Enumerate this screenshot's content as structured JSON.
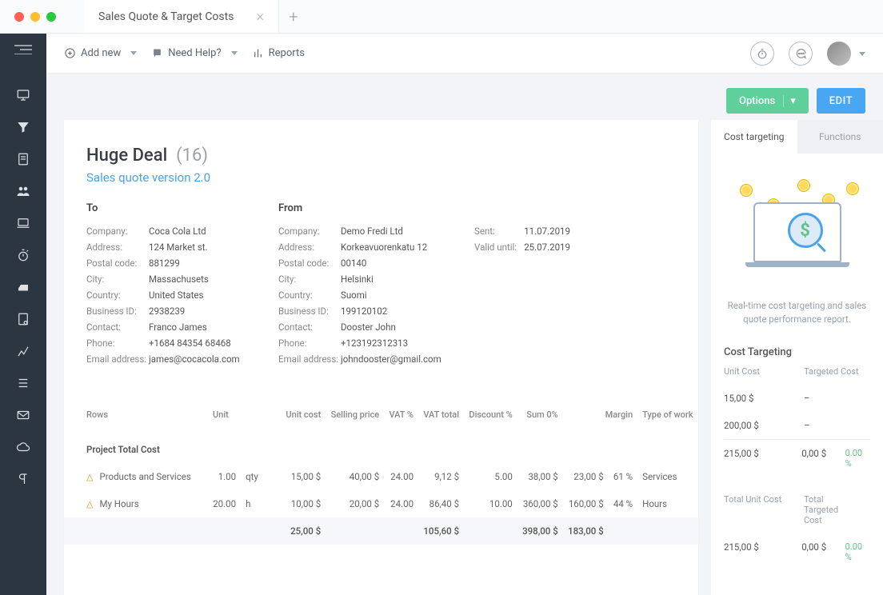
{
  "window": {
    "tab_title": "Sales Quote & Target Costs"
  },
  "toolbar": {
    "add_new": "Add new",
    "need_help": "Need Help?",
    "reports": "Reports"
  },
  "actions": {
    "options": "Options",
    "edit": "EDIT"
  },
  "deal": {
    "title": "Huge Deal",
    "count": "(16)",
    "subtitle": "Sales quote version 2.0"
  },
  "to": {
    "heading": "To",
    "company_l": "Company:",
    "company": "Coca Cola Ltd",
    "address_l": "Address:",
    "address": "124 Market st.",
    "postal_l": "Postal code:",
    "postal": "881299",
    "city_l": "City:",
    "city": "Massachusets",
    "country_l": "Country:",
    "country": "United States",
    "bizid_l": "Business ID:",
    "bizid": "2938239",
    "contact_l": "Contact:",
    "contact": "Franco James",
    "phone_l": "Phone:",
    "phone": "+1684 84354 68468",
    "email_l": "Email address:",
    "email": "james@cocacola.com"
  },
  "from": {
    "heading": "From",
    "company_l": "Company:",
    "company": "Demo Fredi Ltd",
    "address_l": "Address:",
    "address": "Korkeavuorenkatu 12",
    "postal_l": "Postal code:",
    "postal": "00140",
    "city_l": "City:",
    "city": "Helsinki",
    "country_l": "Country:",
    "country": "Suomi",
    "bizid_l": "Business ID:",
    "bizid": "199120102",
    "contact_l": "Contact:",
    "contact": "Dooster John",
    "phone_l": "Phone:",
    "phone": "+123192312313",
    "email_l": "Email address:",
    "email": "johndooster@gmail.com"
  },
  "dates": {
    "sent_l": "Sent:",
    "sent": "11.07.2019",
    "valid_l": "Valid until:",
    "valid": "25.07.2019"
  },
  "table": {
    "headers": {
      "rows": "Rows",
      "unit": "Unit",
      "unit_cost": "Unit cost",
      "selling": "Selling price",
      "vatp": "VAT %",
      "vatt": "VAT total",
      "discount": "Discount %",
      "sum0": "Sum 0%",
      "margin": "Margin",
      "type": "Type of work"
    },
    "section": "Project Total Cost",
    "rows": [
      {
        "name": "Products and Services",
        "qty": "1.00",
        "unit": "qty",
        "ucost": "15,00 $",
        "sell": "40,00 $",
        "vatp": "24.00",
        "vatt": "9,12 $",
        "disc": "5.00",
        "sum": "38,00 $",
        "marg": "23,00 $",
        "mpct": "61 %",
        "type": "Services"
      },
      {
        "name": "My Hours",
        "qty": "20.00",
        "unit": "h",
        "ucost": "10,00 $",
        "sell": "20,00 $",
        "vatp": "24.00",
        "vatt": "86,40 $",
        "disc": "10.00",
        "sum": "360,00 $",
        "marg": "160,00 $",
        "mpct": "44 %",
        "type": "Hours"
      }
    ],
    "totals": {
      "ucost": "25,00 $",
      "vatt": "105,60 $",
      "sum": "398,00 $",
      "marg": "183,00 $"
    }
  },
  "panel": {
    "tabs": {
      "targeting": "Cost targeting",
      "functions": "Functions"
    },
    "caption": "Real-time cost targeting and sales quote performance report.",
    "heading": "Cost Targeting",
    "cols": {
      "uc": "Unit Cost",
      "tc": "Targeted Cost"
    },
    "lines": [
      {
        "uc": "15,00 $",
        "tc": "–",
        "pct": ""
      },
      {
        "uc": "200,00 $",
        "tc": "–",
        "pct": ""
      },
      {
        "uc": "215,00 $",
        "tc": "0,00 $",
        "pct": "0.00 %"
      }
    ],
    "total_cols": {
      "tuc": "Total Unit Cost",
      "ttc": "Total Targeted Cost"
    },
    "total_line": {
      "uc": "215,00 $",
      "tc": "0,00 $",
      "pct": "0.00 %"
    }
  }
}
